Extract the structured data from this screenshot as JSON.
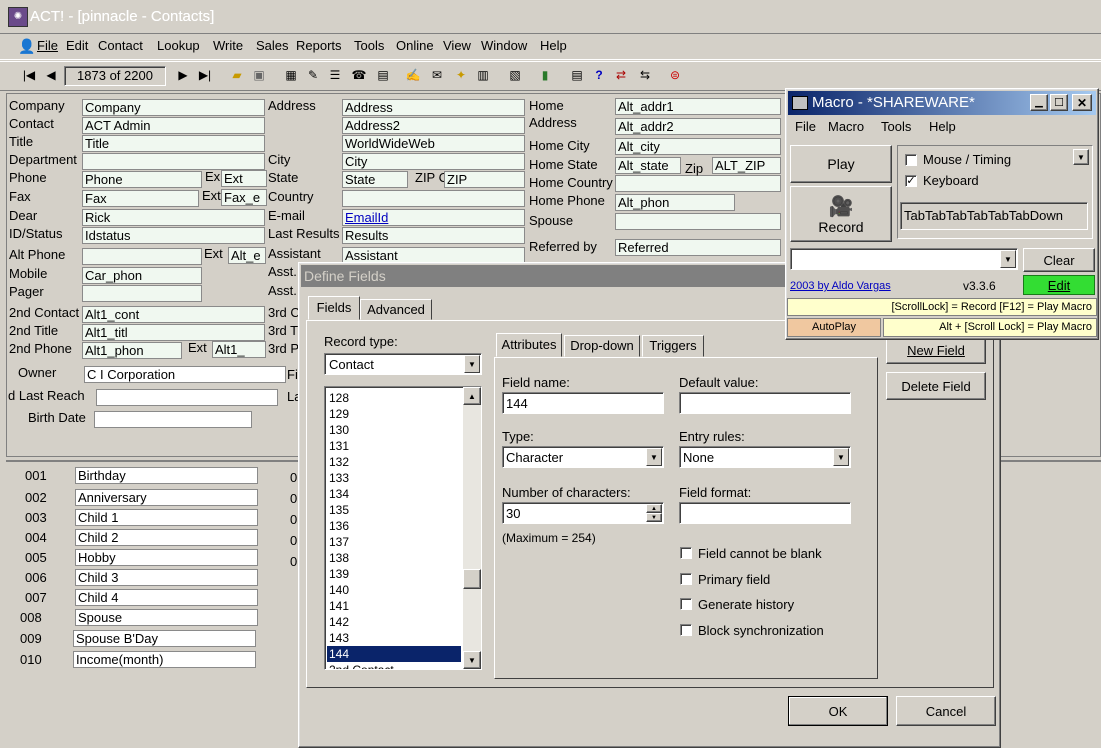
{
  "app": {
    "title": "ACT! - [pinnacle - Contacts]",
    "menu": [
      "File",
      "Edit",
      "Contact",
      "Lookup",
      "Write",
      "Sales",
      "Reports",
      "Tools",
      "Online",
      "View",
      "Window",
      "Help"
    ],
    "record_counter": "1873 of 2200"
  },
  "contact": {
    "col1": [
      {
        "label": "Company",
        "value": "Company"
      },
      {
        "label": "Contact",
        "value": "ACT Admin"
      },
      {
        "label": "Title",
        "value": "Title"
      },
      {
        "label": "Department",
        "value": ""
      },
      {
        "label": "Phone",
        "value": "Phone"
      },
      {
        "label": "Fax",
        "value": "Fax"
      },
      {
        "label": "Dear",
        "value": "Rick"
      },
      {
        "label": "ID/Status",
        "value": "Idstatus"
      },
      {
        "label": "Alt Phone",
        "value": ""
      },
      {
        "label": "Mobile",
        "value": "Car_phon"
      },
      {
        "label": "Pager",
        "value": ""
      },
      {
        "label": "2nd Contact",
        "value": "Alt1_cont"
      },
      {
        "label": "2nd Title",
        "value": "Alt1_titl"
      },
      {
        "label": "2nd Phone",
        "value": "Alt1_phon"
      }
    ],
    "ext_labels": {
      "phone": "Ex",
      "fax": "Ext",
      "alt": "Ext",
      "second": "Ext"
    },
    "ext_values": {
      "phone": "Ext",
      "fax": "Fax_e",
      "alt": "Alt_e",
      "second": "Alt1_"
    },
    "owner_label": "Owner",
    "owner_value": "C I Corporation",
    "last_reach_label": "d Last Reach",
    "birth_label": "Birth Date",
    "col2": [
      {
        "label": "Address",
        "value": "Address"
      },
      {
        "label": "",
        "value": "Address2"
      },
      {
        "label": "",
        "value": "WorldWideWeb"
      },
      {
        "label": "City",
        "value": "City"
      },
      {
        "label": "State",
        "value": "State"
      },
      {
        "label": "Country",
        "value": ""
      },
      {
        "label": "E-mail",
        "value": "EmailId"
      },
      {
        "label": "Last Results",
        "value": "Results"
      },
      {
        "label": "Assistant",
        "value": "Assistant"
      },
      {
        "label": "Asst.",
        "value": ""
      },
      {
        "label": "Asst.",
        "value": ""
      },
      {
        "label": "3rd C",
        "value": ""
      },
      {
        "label": "3rd T",
        "value": ""
      },
      {
        "label": "3rd P",
        "value": ""
      }
    ],
    "zip_label": "ZIP C",
    "zip_value": "ZIP",
    "lbl_fi": "Fi",
    "lbl_la": "La",
    "col3": [
      {
        "label": "Home",
        "value": "Alt_addr1"
      },
      {
        "label": "Address",
        "value": "Alt_addr2"
      },
      {
        "label": "Home City",
        "value": "Alt_city"
      },
      {
        "label": "Home State",
        "value": "Alt_state"
      },
      {
        "label": "Home Country",
        "value": ""
      },
      {
        "label": "Home Phone",
        "value": "Alt_phon"
      },
      {
        "label": "Spouse",
        "value": ""
      },
      {
        "label": "Referred by",
        "value": "Referred"
      }
    ],
    "home_zip_label": "Zip",
    "home_zip_value": "ALT_ZIP"
  },
  "user_fields": [
    {
      "num": "001",
      "value": "Birthday"
    },
    {
      "num": "002",
      "value": "Anniversary"
    },
    {
      "num": "003",
      "value": "Child 1"
    },
    {
      "num": "004",
      "value": "Child 2"
    },
    {
      "num": "005",
      "value": "Hobby"
    },
    {
      "num": "006",
      "value": "Child 3"
    },
    {
      "num": "007",
      "value": "Child 4"
    },
    {
      "num": "008",
      "value": "Spouse"
    },
    {
      "num": "009",
      "value": "Spouse B'Day"
    },
    {
      "num": "010",
      "value": "Income(month)"
    }
  ],
  "user_fields_col2": [
    "0",
    "0",
    "0",
    "0",
    "0"
  ],
  "dialog": {
    "title": "Define Fields",
    "tabs": [
      "Fields",
      "Advanced"
    ],
    "record_type_label": "Record type:",
    "record_type_value": "Contact",
    "fields_list": [
      "128",
      "129",
      "130",
      "131",
      "132",
      "133",
      "134",
      "135",
      "136",
      "137",
      "138",
      "139",
      "140",
      "141",
      "142",
      "143",
      "144",
      "2nd Contact"
    ],
    "selected_field": "144",
    "attr_tabs": [
      "Attributes",
      "Drop-down",
      "Triggers"
    ],
    "field_name_label": "Field name:",
    "field_name_value": "144",
    "default_value_label": "Default value:",
    "default_value": "",
    "type_label": "Type:",
    "type_value": "Character",
    "entry_rules_label": "Entry rules:",
    "entry_rules_value": "None",
    "num_chars_label": "Number of characters:",
    "num_chars_value": "30",
    "maximum_text": "(Maximum = 254)",
    "field_format_label": "Field format:",
    "field_format_value": "",
    "checkboxes": [
      "Field cannot be blank",
      "Primary field",
      "Generate history",
      "Block synchronization"
    ],
    "new_field": "New Field",
    "delete_field": "Delete Field",
    "ok": "OK",
    "cancel": "Cancel"
  },
  "macro": {
    "title": "Macro - *SHAREWARE*",
    "menu": [
      "File",
      "Macro",
      "Tools",
      "Help"
    ],
    "play": "Play",
    "record": "Record",
    "mouse_timing": "Mouse / Timing",
    "keyboard": "Keyboard",
    "keys_text": "TabTabTabTabTabTabDown",
    "combo_value": "",
    "clear": "Clear",
    "credit": "2003 by Aldo Vargas",
    "version": "v3.3.6",
    "edit": "Edit",
    "hint1": "[ScrollLock] = Record   [F12] = Play Macro",
    "autoplay": "AutoPlay",
    "hint2": "Alt + [Scroll Lock] = Play Macro"
  },
  "colors": {
    "title_active": "#0a246a",
    "selection": "#0a246a",
    "edit_green": "#33dd33",
    "hint_yellow": "#ffffcc",
    "autoplay": "#f0c8a0"
  }
}
